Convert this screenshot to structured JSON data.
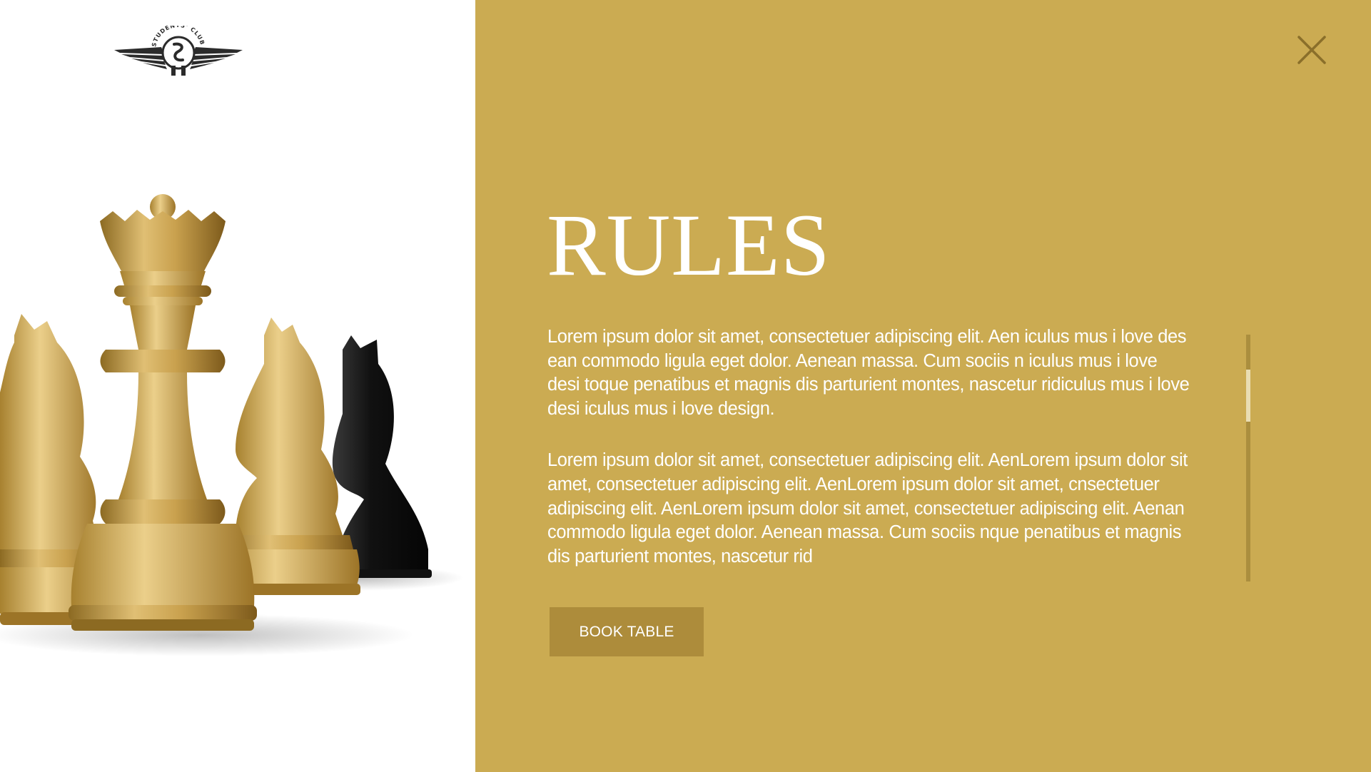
{
  "brand": {
    "logo_text": "STUDENTS' CLUB",
    "logo_icon": "winged-seal-logo"
  },
  "hero_image": {
    "icon": "chess-pieces-image"
  },
  "close": {
    "icon": "close-icon"
  },
  "rules": {
    "title": "RULES",
    "paragraph_1": "Lorem ipsum dolor sit amet, consectetuer adipiscing elit. Aen iculus mus i love des ean commodo ligula eget dolor. Aenean massa. Cum sociis n iculus mus i love desi toque penatibus et magnis dis parturient montes, nascetur ridiculus mus i love desi iculus mus i love design.",
    "paragraph_2": "Lorem ipsum dolor sit amet, consectetuer adipiscing elit. AenLorem ipsum dolor sit amet, consectetuer adipiscing elit. AenLorem ipsum dolor sit amet, cnsectetuer adipiscing elit. AenLorem ipsum dolor sit amet, consectetuer adipiscing elit. Aenan commodo ligula eget dolor. Aenean massa. Cum sociis nque penatibus et magnis dis parturient montes, nascetur rid"
  },
  "actions": {
    "book_label": "BOOK TABLE"
  },
  "colors": {
    "accent": "#cbab52",
    "button": "#ad8c3b",
    "scroll_track": "#ab8e3e",
    "scroll_thumb": "#e9ddb2",
    "close_icon": "#8a6f2a"
  }
}
